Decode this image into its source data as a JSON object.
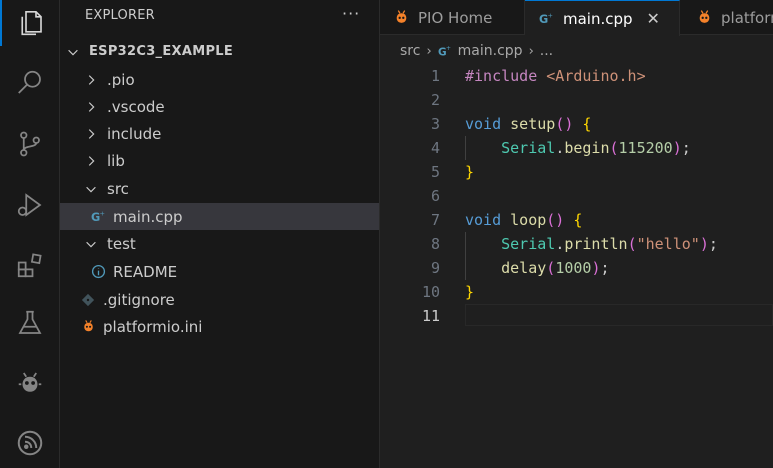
{
  "explorer": {
    "title": "EXPLORER",
    "more": "···",
    "project": "ESP32C3_EXAMPLE",
    "items": [
      {
        "label": ".pio",
        "type": "folder",
        "open": false,
        "depth": 1
      },
      {
        "label": ".vscode",
        "type": "folder",
        "open": false,
        "depth": 1
      },
      {
        "label": "include",
        "type": "folder",
        "open": false,
        "depth": 1
      },
      {
        "label": "lib",
        "type": "folder",
        "open": false,
        "depth": 1
      },
      {
        "label": "src",
        "type": "folder",
        "open": true,
        "depth": 1
      },
      {
        "label": "main.cpp",
        "type": "cpp",
        "depth": 2,
        "selected": true
      },
      {
        "label": "test",
        "type": "folder",
        "open": true,
        "depth": 1
      },
      {
        "label": "README",
        "type": "info",
        "depth": 2
      },
      {
        "label": ".gitignore",
        "type": "git",
        "depth": 1
      },
      {
        "label": "platformio.ini",
        "type": "pio",
        "depth": 1
      }
    ]
  },
  "tabs": [
    {
      "label": "PIO Home",
      "icon": "platformio-icon",
      "active": false
    },
    {
      "label": "main.cpp",
      "icon": "cpp-icon",
      "active": true,
      "close": "✕"
    },
    {
      "label": "platformio.ini",
      "icon": "platformio-icon",
      "active": false
    }
  ],
  "breadcrumb": {
    "folder": "src",
    "file": "main.cpp",
    "more": "..."
  },
  "editor": {
    "current_line": 11,
    "lines": [
      [
        {
          "t": "#include ",
          "c": "#c586c0"
        },
        {
          "t": "<Arduino.h>",
          "c": "#ce9178"
        }
      ],
      [],
      [
        {
          "t": "void ",
          "c": "#569cd6"
        },
        {
          "t": "setup",
          "c": "#dcdcaa"
        },
        {
          "t": "() ",
          "c": "#da70d6"
        },
        {
          "t": "{",
          "c": "#ffd700"
        }
      ],
      [
        {
          "t": "    ",
          "c": "#cccccc"
        },
        {
          "t": "Serial",
          "c": "#4ec9b0"
        },
        {
          "t": ".",
          "c": "#cccccc"
        },
        {
          "t": "begin",
          "c": "#dcdcaa"
        },
        {
          "t": "(",
          "c": "#da70d6"
        },
        {
          "t": "115200",
          "c": "#b5cea8"
        },
        {
          "t": ")",
          "c": "#da70d6"
        },
        {
          "t": ";",
          "c": "#cccccc"
        }
      ],
      [
        {
          "t": "}",
          "c": "#ffd700"
        }
      ],
      [],
      [
        {
          "t": "void ",
          "c": "#569cd6"
        },
        {
          "t": "loop",
          "c": "#dcdcaa"
        },
        {
          "t": "() ",
          "c": "#da70d6"
        },
        {
          "t": "{",
          "c": "#ffd700"
        }
      ],
      [
        {
          "t": "    ",
          "c": "#cccccc"
        },
        {
          "t": "Serial",
          "c": "#4ec9b0"
        },
        {
          "t": ".",
          "c": "#cccccc"
        },
        {
          "t": "println",
          "c": "#dcdcaa"
        },
        {
          "t": "(",
          "c": "#da70d6"
        },
        {
          "t": "\"hello\"",
          "c": "#ce9178"
        },
        {
          "t": ")",
          "c": "#da70d6"
        },
        {
          "t": ";",
          "c": "#cccccc"
        }
      ],
      [
        {
          "t": "    ",
          "c": "#cccccc"
        },
        {
          "t": "delay",
          "c": "#dcdcaa"
        },
        {
          "t": "(",
          "c": "#da70d6"
        },
        {
          "t": "1000",
          "c": "#b5cea8"
        },
        {
          "t": ")",
          "c": "#da70d6"
        },
        {
          "t": ";",
          "c": "#cccccc"
        }
      ],
      [
        {
          "t": "}",
          "c": "#ffd700"
        }
      ],
      []
    ]
  },
  "colors": {
    "accent": "#0078d4",
    "pio_orange": "#f5822a",
    "cpp_blue": "#519aba"
  }
}
